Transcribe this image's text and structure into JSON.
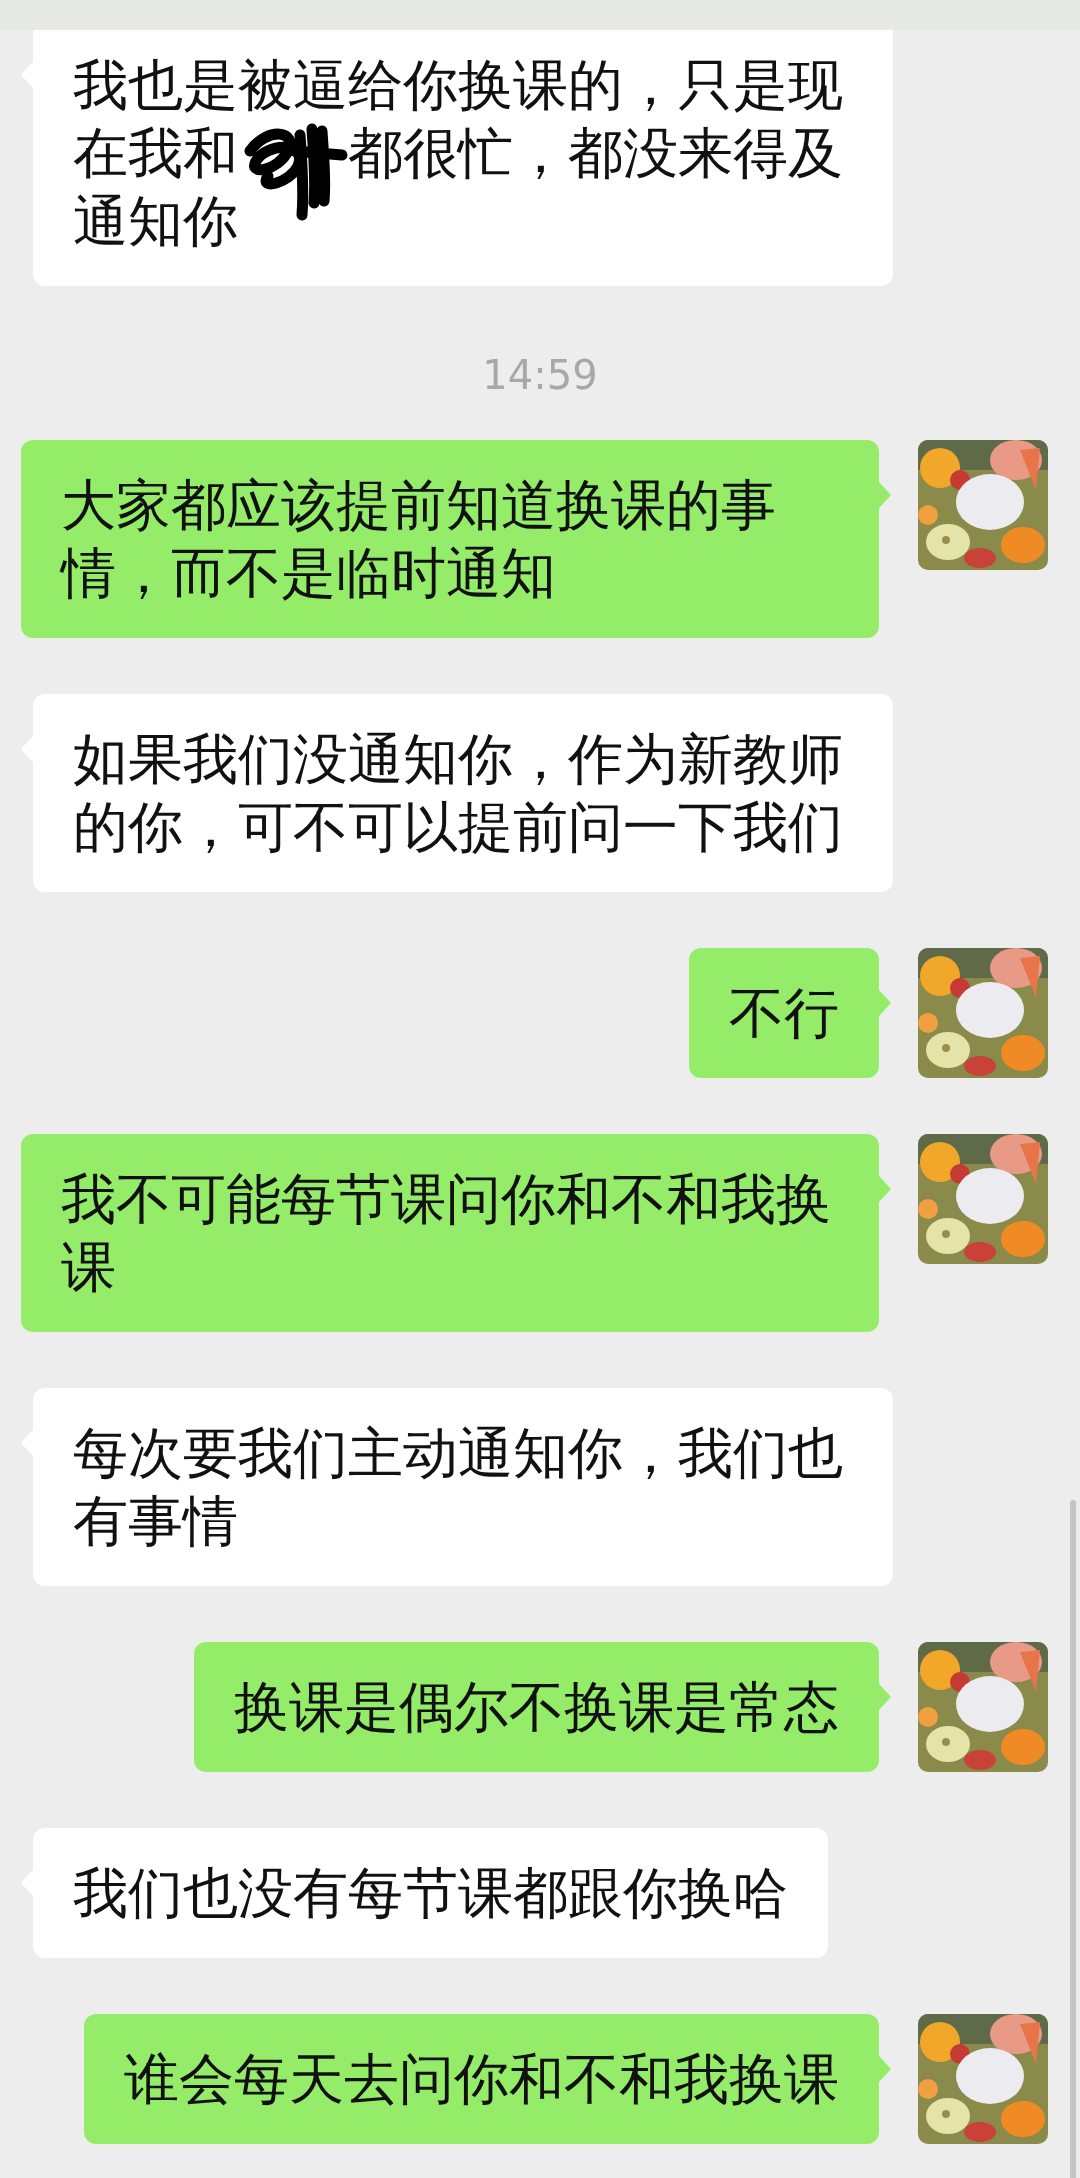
{
  "messages": [
    {
      "kind": "incoming",
      "parts": [
        "我也是被逼给你换课的，只是现在我和",
        "都很忙，都没来得及通知你"
      ]
    },
    {
      "kind": "time",
      "parts": [
        "14:59"
      ]
    },
    {
      "kind": "outgoing",
      "parts": [
        "大家都应该提前知道换课的事情，而不是临时通知"
      ]
    },
    {
      "kind": "incoming",
      "parts": [
        "如果我们没通知你，作为新教师的你，可不可以提前问一下我们"
      ]
    },
    {
      "kind": "outgoing",
      "parts": [
        "不行"
      ]
    },
    {
      "kind": "outgoing",
      "parts": [
        "我不可能每节课问你和不和我换课"
      ]
    },
    {
      "kind": "incoming",
      "parts": [
        "每次要我们主动通知你，我们也有事情"
      ]
    },
    {
      "kind": "outgoing",
      "parts": [
        "换课是偶尔不换课是常态"
      ]
    },
    {
      "kind": "incoming",
      "parts": [
        "我们也没有每节课都跟你换哈"
      ]
    },
    {
      "kind": "outgoing",
      "parts": [
        "谁会每天去问你和不和我换课"
      ]
    }
  ]
}
